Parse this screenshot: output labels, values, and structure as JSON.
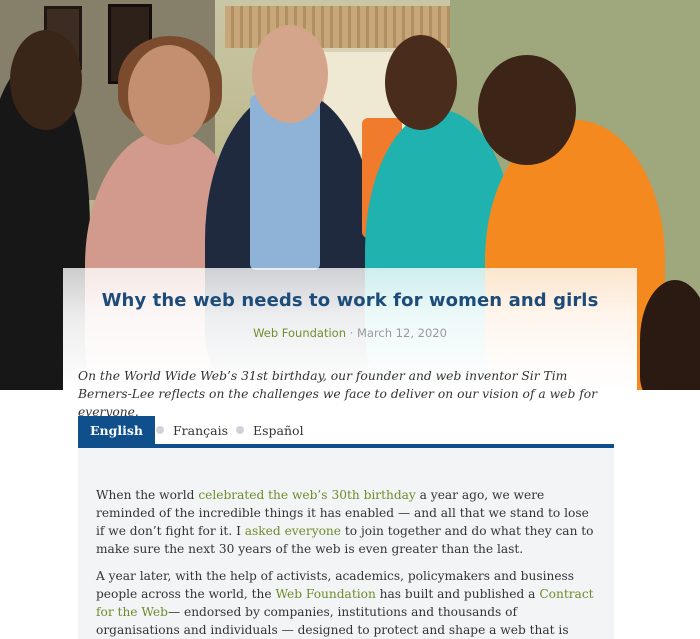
{
  "article": {
    "title": "Why the web needs to work for women and girls",
    "author": "Web Foundation",
    "separator": " · ",
    "date": "March 12, 2020",
    "intro": "On the World Wide Web’s 31st birthday, our founder and web inventor Sir Tim Berners-Lee reflects on the challenges we face to deliver on our vision of a web for everyone.",
    "tabs": [
      {
        "label": "English"
      },
      {
        "label": "Français"
      },
      {
        "label": "Español"
      }
    ],
    "p1": {
      "a": "When the world ",
      "link1": "celebrated the web’s 30th birthday",
      "b": " a year ago, we were reminded of the incredible things it has enabled — and all that we stand to lose if we don’t fight for it. I ",
      "link2": "asked everyone",
      "c": " to join together and do what they can to make sure the next 30 years of the web is even greater than the last."
    },
    "p2": {
      "a": "A year later, with the help of activists, academics, policymakers and business people across the world, the ",
      "link1": "Web Foundation",
      "b": " has built and published a ",
      "link2": "Contract for the Web",
      "c": "— endorsed by companies, institutions and thousands of organisations and individuals — designed to protect and shape a web that is safe, empowering and available to all."
    }
  },
  "colors": {
    "title": "#1d4c7a",
    "link": "#6b8d2b",
    "tab_active": "#0f4f8c",
    "body_bg": "#f3f4f6"
  }
}
